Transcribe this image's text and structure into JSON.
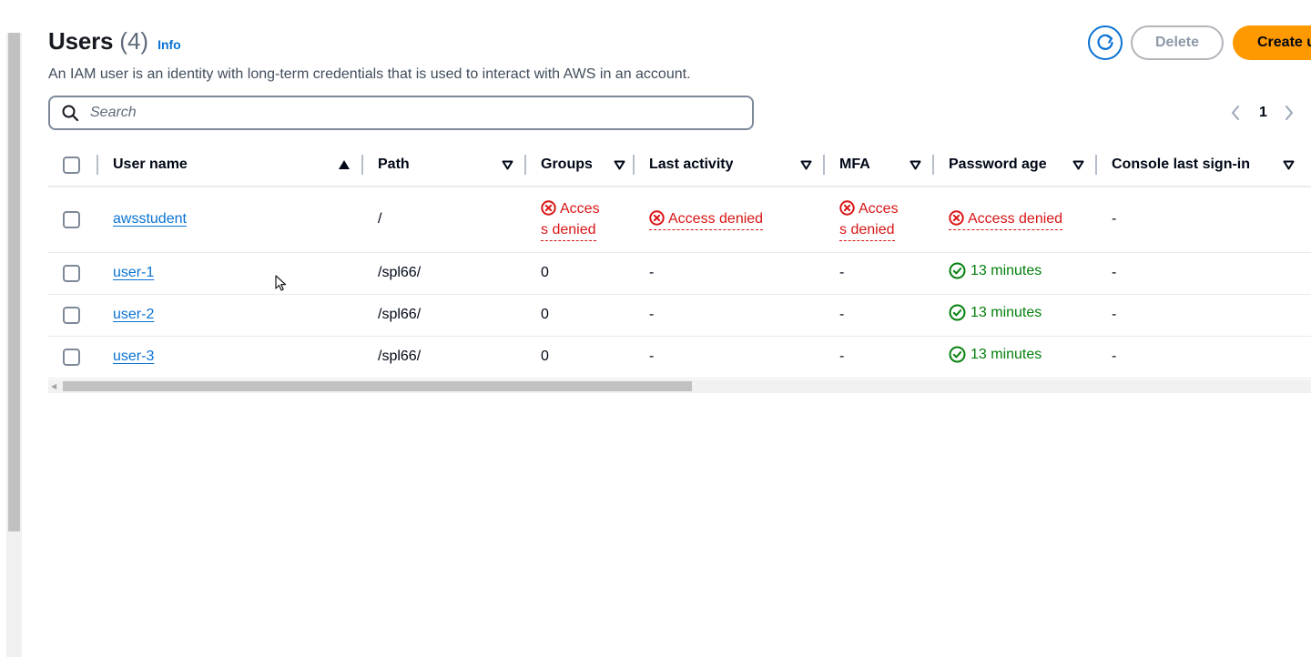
{
  "header": {
    "title": "Users",
    "count": "(4)",
    "info_link": "Info",
    "description": "An IAM user is an identity with long-term credentials that is used to interact with AWS in an account."
  },
  "actions": {
    "refresh_icon": "refresh-icon",
    "delete_label": "Delete",
    "create_label": "Create user"
  },
  "search": {
    "placeholder": "Search",
    "value": ""
  },
  "pagination": {
    "current_page": "1"
  },
  "table": {
    "columns": [
      {
        "label": "User name",
        "sort": "ascending"
      },
      {
        "label": "Path",
        "sort": "none"
      },
      {
        "label": "Groups",
        "sort": "none"
      },
      {
        "label": "Last activity",
        "sort": "none"
      },
      {
        "label": "MFA",
        "sort": "none"
      },
      {
        "label": "Password age",
        "sort": "none"
      },
      {
        "label": "Console last sign-in",
        "sort": "none"
      }
    ],
    "rows": [
      {
        "user_name": "awsstudent",
        "path": "/",
        "groups_a": "Acces",
        "groups_b": "s denied",
        "last_activity": "Access denied",
        "mfa_a": "Acces",
        "mfa_b": "s denied",
        "password_age": "Access denied",
        "console_last_sign_in": "-"
      },
      {
        "user_name": "user-1",
        "path": "/spl66/",
        "groups": "0",
        "last_activity": "-",
        "mfa": "-",
        "password_age": "13 minutes",
        "console_last_sign_in": "-"
      },
      {
        "user_name": "user-2",
        "path": "/spl66/",
        "groups": "0",
        "last_activity": "-",
        "mfa": "-",
        "password_age": "13 minutes",
        "console_last_sign_in": "-"
      },
      {
        "user_name": "user-3",
        "path": "/spl66/",
        "groups": "0",
        "last_activity": "-",
        "mfa": "-",
        "password_age": "13 minutes",
        "console_last_sign_in": "-"
      }
    ]
  },
  "colors": {
    "link": "#0972d3",
    "error": "#d91515",
    "success": "#037f0c",
    "primary_button": "#ff9900"
  }
}
